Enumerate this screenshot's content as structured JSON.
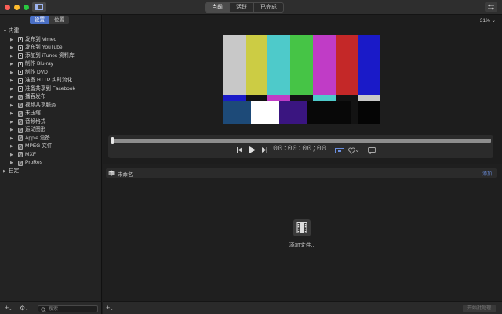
{
  "titlebar": {
    "tabs": [
      {
        "label": "当前",
        "active": true
      },
      {
        "label": "活跃",
        "active": false
      },
      {
        "label": "已完成",
        "active": false
      }
    ]
  },
  "sidebar": {
    "tabs": [
      {
        "label": "设置",
        "active": true
      },
      {
        "label": "位置",
        "active": false
      }
    ],
    "groups": [
      {
        "label": "内建",
        "expanded": true,
        "items": [
          {
            "label": "发布到 Vimeo",
            "icon": "device-icon"
          },
          {
            "label": "发布到 YouTube",
            "icon": "device-icon"
          },
          {
            "label": "添加到 iTunes 资料库",
            "icon": "device-icon"
          },
          {
            "label": "制作 Blu-ray",
            "icon": "device-icon"
          },
          {
            "label": "制作 DVD",
            "icon": "device-icon"
          },
          {
            "label": "准备 HTTP 实时流化",
            "icon": "device-icon"
          },
          {
            "label": "准备共享到 Facebook",
            "icon": "device-icon"
          },
          {
            "label": "播客发布",
            "icon": "setting-icon"
          },
          {
            "label": "视频共享服务",
            "icon": "setting-icon"
          },
          {
            "label": "未压缩",
            "icon": "setting-icon"
          },
          {
            "label": "音频格式",
            "icon": "setting-icon"
          },
          {
            "label": "运动图形",
            "icon": "setting-icon"
          },
          {
            "label": "Apple 设备",
            "icon": "setting-icon"
          },
          {
            "label": "MPEG 文件",
            "icon": "setting-icon"
          },
          {
            "label": "MXF",
            "icon": "setting-icon"
          },
          {
            "label": "ProRes",
            "icon": "setting-icon"
          }
        ]
      },
      {
        "label": "自定",
        "expanded": false,
        "items": []
      }
    ],
    "search": {
      "placeholder": "搜索"
    }
  },
  "viewer": {
    "zoom": "31%",
    "timecode": "00:00:00;00",
    "test_pattern": {
      "top_bars": [
        "#c8c8c8",
        "#cccc44",
        "#4ecaca",
        "#46c446",
        "#c03cc6",
        "#c42828",
        "#1a1ac8"
      ],
      "mid_bars": [
        "#1a1ac8",
        "#131313",
        "#c03cc6",
        "#131313",
        "#4ecaca",
        "#131313",
        "#c8c8c8"
      ],
      "bottom_bars": [
        {
          "color": "#1d4a78",
          "weight": 36
        },
        {
          "color": "#ffffff",
          "weight": 36
        },
        {
          "color": "#3a1580",
          "weight": 36
        },
        {
          "color": "#080808",
          "weight": 56
        },
        {
          "color": "#131313",
          "weight": 9
        },
        {
          "color": "#050505",
          "weight": 28
        }
      ]
    }
  },
  "batch": {
    "title": "未命名",
    "add_label": "添加",
    "drop_label": "添加文件..."
  },
  "footer": {
    "start_button": "开始批处理"
  }
}
